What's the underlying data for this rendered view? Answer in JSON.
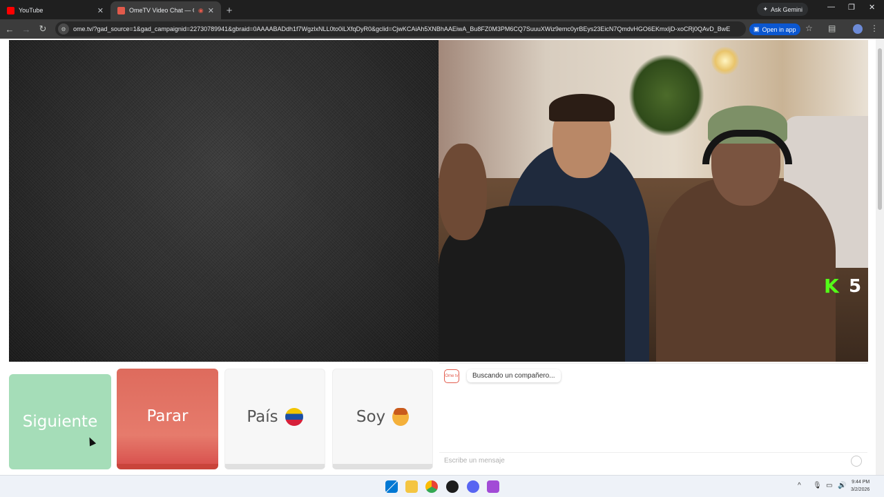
{
  "browser": {
    "tabs": [
      {
        "title": "YouTube",
        "active": false,
        "favicon_color": "#ff0000"
      },
      {
        "title": "OmeTV Video Chat — Ome",
        "active": true,
        "favicon_color": "#e25a4b"
      }
    ],
    "ask_gemini": "Ask Gemini",
    "url": "ome.tv/?gad_source=1&gad_campaignid=22730789941&gbraid=0AAAABADdh1f7WgzlxNLL0to0iLXfqDyR0&gclid=CjwKCAiAh5XNBhAAEiwA_Bu8FZ0M3PM6CQ7SuuuXWiz9emc0yrBEys23EicN7QmdvHGO6EKmxljD-xoCRj0QAvD_BwE",
    "open_in_app": "Open in app"
  },
  "stream_overlay": {
    "logo_letter": "K",
    "count": "5"
  },
  "controls": {
    "next_label": "Siguiente",
    "stop_label": "Parar",
    "country_label": "País",
    "country_flag": "venezuela-flag",
    "gender_label": "Soy",
    "gender_icon": "boy-emoji"
  },
  "chat": {
    "logo_text": "Ome tv",
    "status_message": "Buscando un compañero...",
    "input_placeholder": "Escribe un mensaje"
  },
  "taskbar": {
    "time": "9:44 PM",
    "date": "3/2/2026"
  },
  "colors": {
    "next": "#a5ddb8",
    "stop": "#de6b5d",
    "kick_green": "#53fc18"
  }
}
